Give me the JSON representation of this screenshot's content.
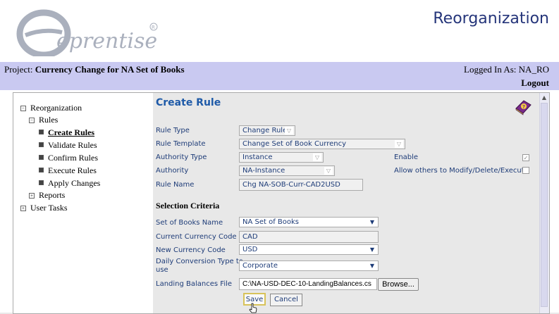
{
  "app": {
    "title": "Reorganization",
    "logo_text": "eprentise"
  },
  "project_bar": {
    "project_label": "Project:",
    "project_name": "Currency Change for NA Set of Books",
    "logged_in": "Logged In As: NA_RO",
    "logout": "Logout"
  },
  "nav": {
    "reorganization": "Reorganization",
    "rules": "Rules",
    "items": [
      {
        "label": "Create Rules"
      },
      {
        "label": "Validate Rules"
      },
      {
        "label": "Confirm Rules"
      },
      {
        "label": "Execute Rules"
      },
      {
        "label": "Apply Changes"
      }
    ],
    "reports": "Reports",
    "user_tasks": "User Tasks"
  },
  "form": {
    "title": "Create Rule",
    "rule_type_label": "Rule Type",
    "rule_type_value": "Change Rule",
    "rule_template_label": "Rule Template",
    "rule_template_value": "Change Set of Book Currency",
    "authority_type_label": "Authority Type",
    "authority_type_value": "Instance",
    "enable_label": "Enable",
    "authority_label": "Authority",
    "authority_value": "NA-Instance",
    "allow_label": "Allow others to Modify/Delete/Execute",
    "rule_name_label": "Rule Name",
    "rule_name_value": "Chg NA-SOB-Curr-CAD2USD",
    "selection_criteria": "Selection Criteria",
    "sob_name_label": "Set of Books Name",
    "sob_name_value": "NA Set of Books",
    "current_currency_label": "Current Currency Code",
    "current_currency_value": "CAD",
    "new_currency_label": "New Currency Code",
    "new_currency_value": "USD",
    "daily_conv_label_1": "Daily Conversion Type to",
    "daily_conv_label_2": "use",
    "daily_conv_value": "Corporate",
    "landing_label": "Landing Balances File",
    "landing_value": "C:\\NA-USD-DEC-10-LandingBalances.cs",
    "browse": "Browse...",
    "save": "Save",
    "cancel": "Cancel"
  },
  "colors": {
    "project_bar": "#c9c9f1",
    "title_blue": "#1e5aa8",
    "label_blue": "#1e3c78"
  }
}
